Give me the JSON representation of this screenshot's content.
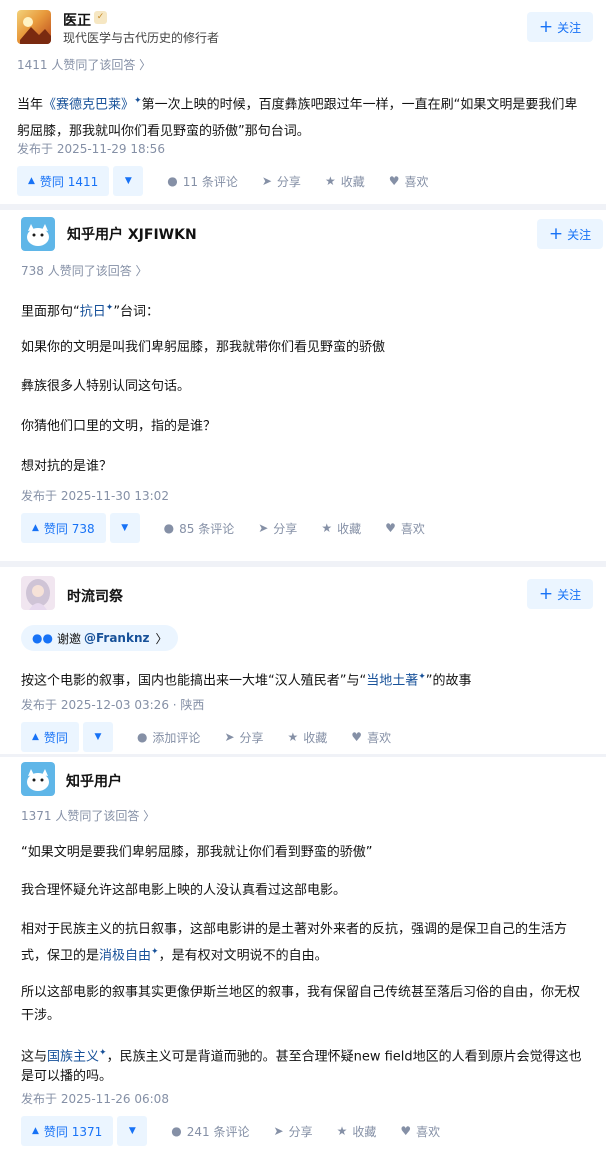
{
  "follow_label": "关注",
  "answers": [
    {
      "author": "医正",
      "bio": "现代医学与古代历史的修行者",
      "voted_meta": "1411 人赞同了该回答 〉",
      "p1_pre": "当年",
      "p1_link": "《赛德克巴莱》",
      "p1_post": "第一次上映的时候，百度彝族吧跟过年一样，一直在刷“如果文明是要我们卑躬屈膝，那我就叫你们看见野蛮的骄傲”那句台词。",
      "time": "发布于 2025-11-29 18:56",
      "vote": "赞同 1411",
      "comments": "11 条评论",
      "share": "分享",
      "fav": "收藏",
      "like": "喜欢"
    },
    {
      "author": "知乎用户 XJFIWKN",
      "voted_meta": "738 人赞同了该回答 〉",
      "p1_pre": "里面那句“",
      "p1_link": "抗日",
      "p1_post": "”台词：",
      "p2": "如果你的文明是叫我们卑躬屈膝，那我就带你们看见野蛮的骄傲",
      "p3": "彝族很多人特别认同这句话。",
      "p4": "你猜他们口里的文明，指的是谁？",
      "p5": "想对抗的是谁？",
      "time": "发布于 2025-11-30 13:02",
      "vote": "赞同 738",
      "comments": "85 条评论",
      "share": "分享",
      "fav": "收藏",
      "like": "喜欢"
    },
    {
      "author": "时流司祭",
      "invite_label": "谢邀",
      "invite_user": "@Franknz",
      "invite_arrow": "〉",
      "p1_pre": "按这个电影的叙事，国内也能搞出来一大堆“汉人殖民者”与“",
      "p1_link": "当地土著",
      "p1_post": "”的故事",
      "time": "发布于 2025-12-03 03:26 · 陕西",
      "vote": "赞同",
      "comments": "添加评论",
      "share": "分享",
      "fav": "收藏",
      "like": "喜欢"
    },
    {
      "author": "知乎用户",
      "voted_meta": "1371 人赞同了该回答 〉",
      "p1": "“如果文明是要我们卑躬屈膝，那我就让你们看到野蛮的骄傲”",
      "p2": "我合理怀疑允许这部电影上映的人没认真看过这部电影。",
      "p3a": "相对于民族主义的抗日叙事，这部电影讲的是土著对外来者的反抗，强调的是保卫自己的生活方",
      "p3b_pre": "式，保卫的是",
      "p3b_link": "消极自由",
      "p3b_post": "，是有权对文明说不的自由。",
      "p4a": "所以这部电影的叙事其实更像伊斯兰地区的叙事，我有保留自己传统甚至落后习俗的自由，你无权",
      "p4b": "干涉。",
      "p5a_pre": "这与",
      "p5a_link": "国族主义",
      "p5a_post": "，民族主义可是背道而驰的。甚至合理怀疑new field地区的人看到原片会觉得这也",
      "p5b": "是可以播的吗。",
      "time": "发布于 2025-11-26 06:08",
      "vote": "赞同 1371",
      "comments": "241 条评论",
      "share": "分享",
      "fav": "收藏",
      "like": "喜欢"
    }
  ],
  "icons": {
    "badge": "verified-badge-icon",
    "plus": "plus-icon",
    "vote_up": "triangle-up-icon",
    "vote_down": "triangle-down-icon",
    "comment": "comment-bubble-icon",
    "share": "paper-plane-icon",
    "fav": "star-icon",
    "like": "heart-icon"
  },
  "colors": {
    "accent": "#1772f6",
    "accent_bg": "#ebf5ff",
    "link": "#175199",
    "meta": "#8590a6",
    "separator": "#f0f2f7"
  }
}
